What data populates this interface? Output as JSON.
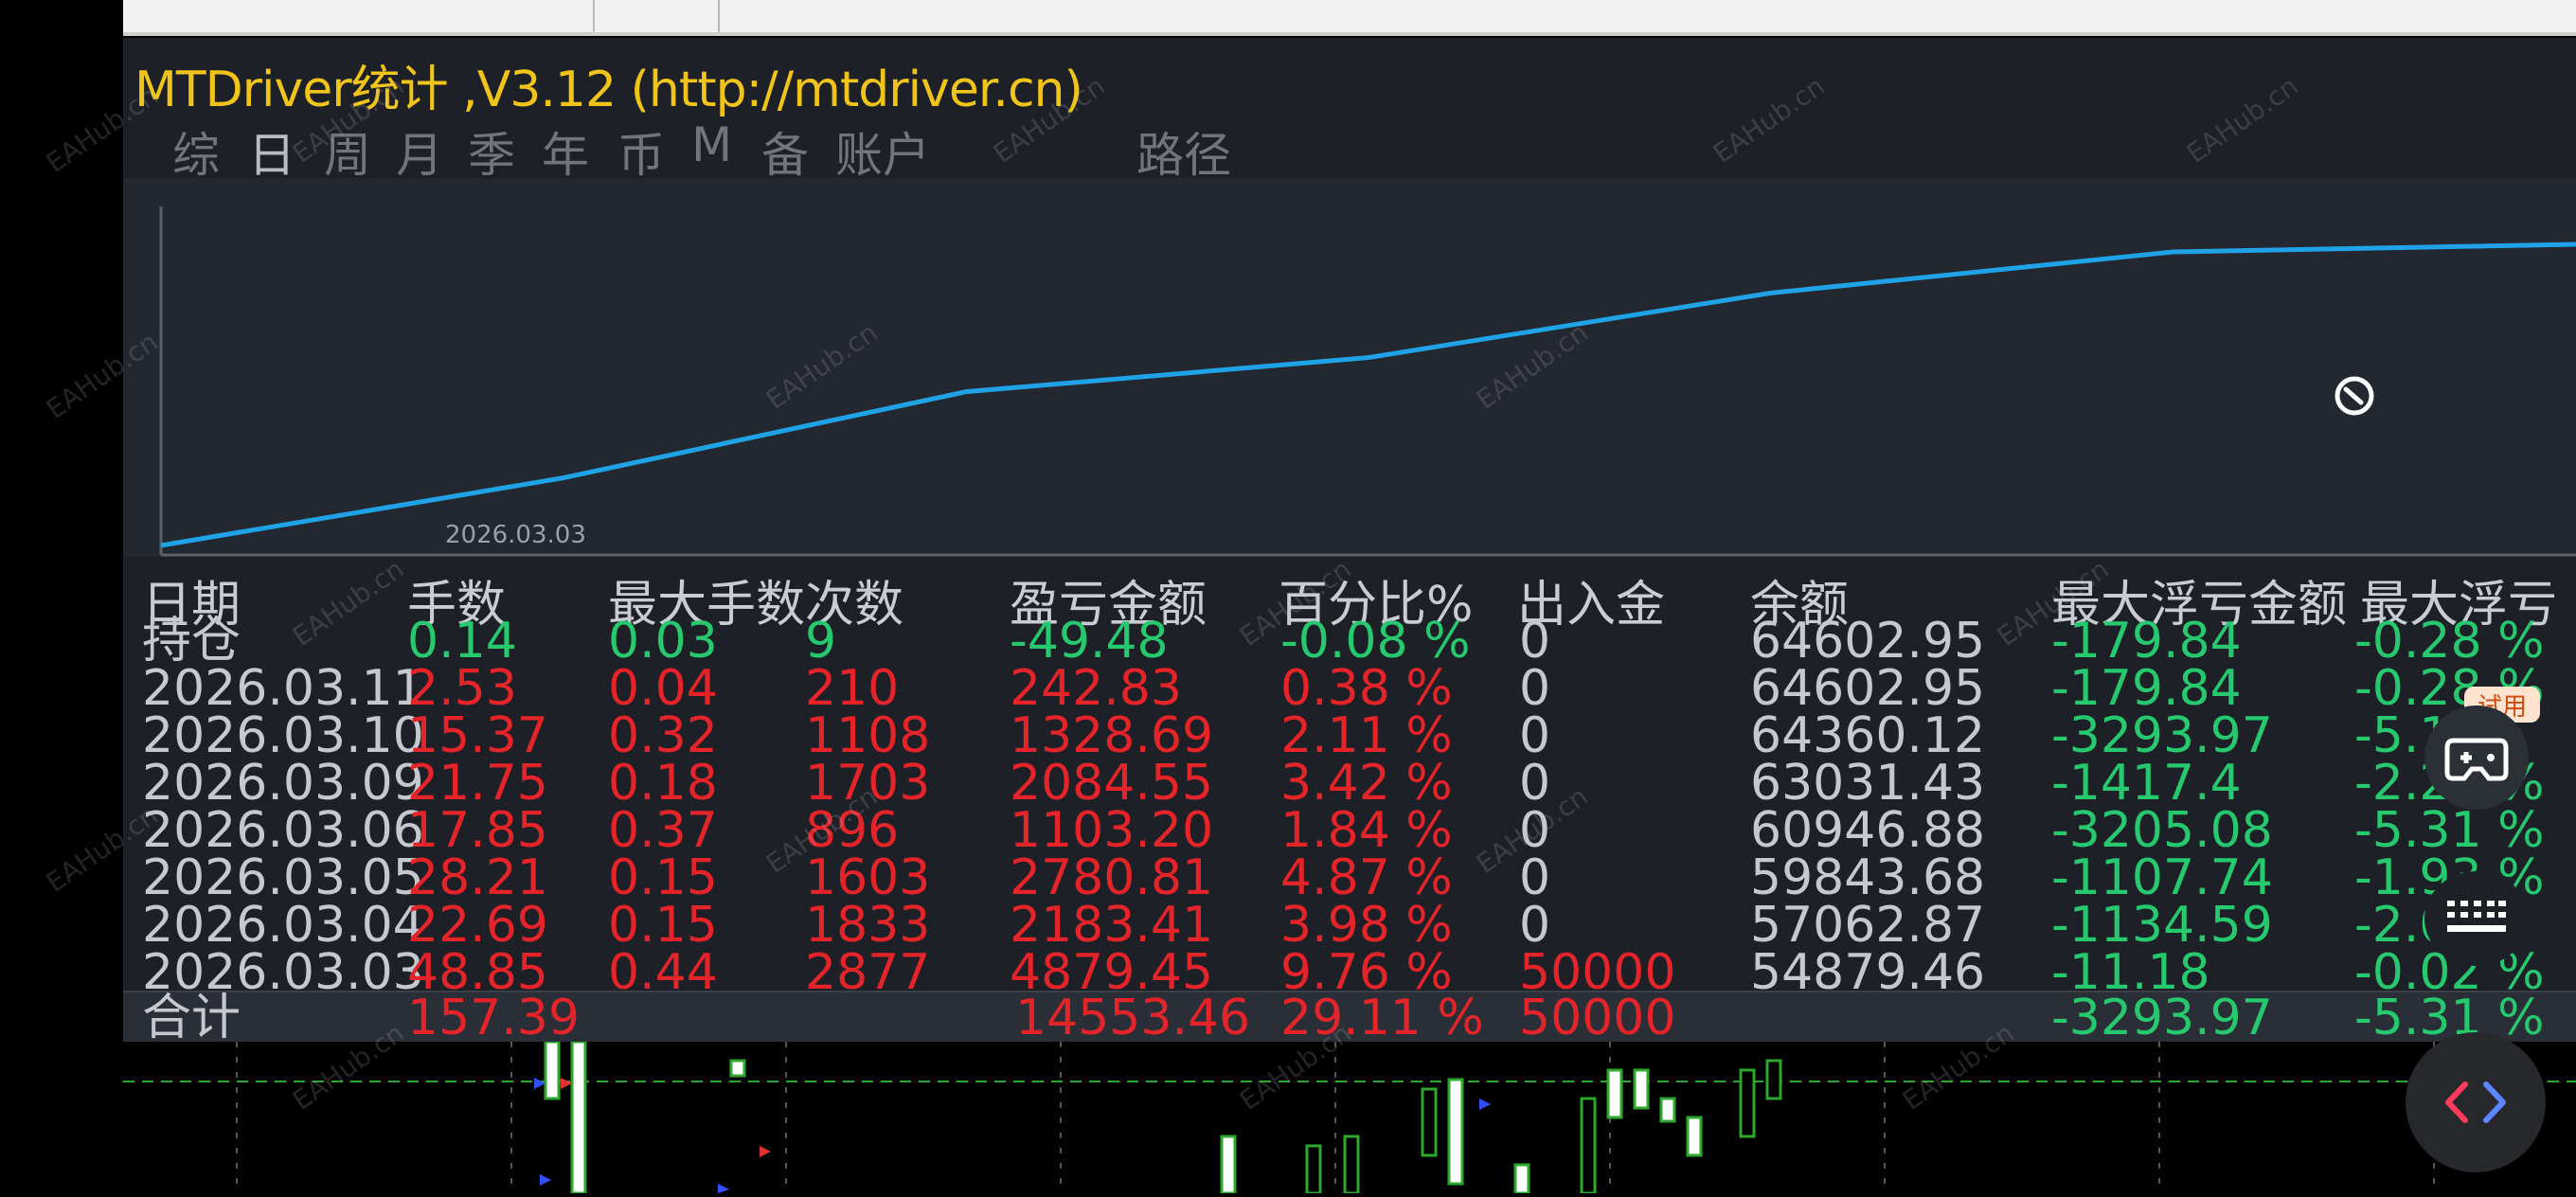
{
  "app": {
    "title": "MTDriver统计 ,V3.12 (http://mtdriver.cn)",
    "watermark": "EAHub.cn"
  },
  "tabs": [
    {
      "label": "综",
      "active": false
    },
    {
      "label": "日",
      "active": true
    },
    {
      "label": "周",
      "active": false
    },
    {
      "label": "月",
      "active": false
    },
    {
      "label": "季",
      "active": false
    },
    {
      "label": "年",
      "active": false
    },
    {
      "label": "币",
      "active": false
    },
    {
      "label": "M",
      "active": false
    },
    {
      "label": "备",
      "active": false
    },
    {
      "label": "账户",
      "active": false
    },
    {
      "label": "路径",
      "active": false
    }
  ],
  "chart_data": {
    "type": "line",
    "title": "",
    "xlabel": "",
    "ylabel": "",
    "x_tick_labels": [
      "2026.03.03"
    ],
    "series": [
      {
        "x": [
          "2026.03.03",
          "2026.03.04",
          "2026.03.05",
          "2026.03.06",
          "2026.03.09",
          "2026.03.10",
          "2026.03.11"
        ],
        "y": [
          54879.46,
          57062.87,
          59843.68,
          60946.88,
          63031.43,
          64360.12,
          64602.95
        ]
      }
    ],
    "color": "#1fa2e6"
  },
  "table": {
    "headers": [
      "日期",
      "手数",
      "最大手数",
      "次数",
      "盈亏金额",
      "百分比%",
      "出入金",
      "余额",
      "最大浮亏金额",
      "最大浮亏"
    ],
    "rows": [
      {
        "date": "持仓",
        "lots": "0.14",
        "max_lots": "0.03",
        "count": "9",
        "pnl": "-49.48",
        "pct": "-0.08 %",
        "flow": "0",
        "balance": "64602.95",
        "max_dd_amt": "-179.84",
        "max_dd": "-0.28 %",
        "color": "green"
      },
      {
        "date": "2026.03.11",
        "lots": "2.53",
        "max_lots": "0.04",
        "count": "210",
        "pnl": "242.83",
        "pct": "0.38 %",
        "flow": "0",
        "balance": "64602.95",
        "max_dd_amt": "-179.84",
        "max_dd": "-0.28 %",
        "color": "red"
      },
      {
        "date": "2026.03.10",
        "lots": "15.37",
        "max_lots": "0.32",
        "count": "1108",
        "pnl": "1328.69",
        "pct": "2.11 %",
        "flow": "0",
        "balance": "64360.12",
        "max_dd_amt": "-3293.97",
        "max_dd": "-5.1 %",
        "color": "red"
      },
      {
        "date": "2026.03.09",
        "lots": "21.75",
        "max_lots": "0.18",
        "count": "1703",
        "pnl": "2084.55",
        "pct": "3.42 %",
        "flow": "0",
        "balance": "63031.43",
        "max_dd_amt": "-1417.4",
        "max_dd": "-2.25 %",
        "color": "red"
      },
      {
        "date": "2026.03.06",
        "lots": "17.85",
        "max_lots": "0.37",
        "count": "896",
        "pnl": "1103.20",
        "pct": "1.84 %",
        "flow": "0",
        "balance": "60946.88",
        "max_dd_amt": "-3205.08",
        "max_dd": "-5.31 %",
        "color": "red"
      },
      {
        "date": "2026.03.05",
        "lots": "28.21",
        "max_lots": "0.15",
        "count": "1603",
        "pnl": "2780.81",
        "pct": "4.87 %",
        "flow": "0",
        "balance": "59843.68",
        "max_dd_amt": "-1107.74",
        "max_dd": "-1.93 %",
        "color": "red"
      },
      {
        "date": "2026.03.04",
        "lots": "22.69",
        "max_lots": "0.15",
        "count": "1833",
        "pnl": "2183.41",
        "pct": "3.98 %",
        "flow": "0",
        "balance": "57062.87",
        "max_dd_amt": "-1134.59",
        "max_dd": "-2.0 %",
        "color": "red"
      },
      {
        "date": "2026.03.03",
        "lots": "48.85",
        "max_lots": "0.44",
        "count": "2877",
        "pnl": "4879.45",
        "pct": "9.76 %",
        "flow": "50000",
        "balance": "54879.46",
        "max_dd_amt": "-11.18",
        "max_dd": "-0.02 %",
        "color": "red"
      }
    ],
    "total": {
      "label": "合计",
      "lots": "157.39",
      "pnl": "14553.46",
      "pct": "29.11 %",
      "flow": "50000",
      "max_dd_amt": "-3293.97",
      "max_dd": "-5.31 %"
    }
  },
  "overlay": {
    "trial_badge": "试用",
    "tag_icon": "tag-icon",
    "game_icon": "gamepad-icon",
    "keyboard_icon": "keyboard-icon",
    "code_icon": "code-brackets-icon"
  }
}
